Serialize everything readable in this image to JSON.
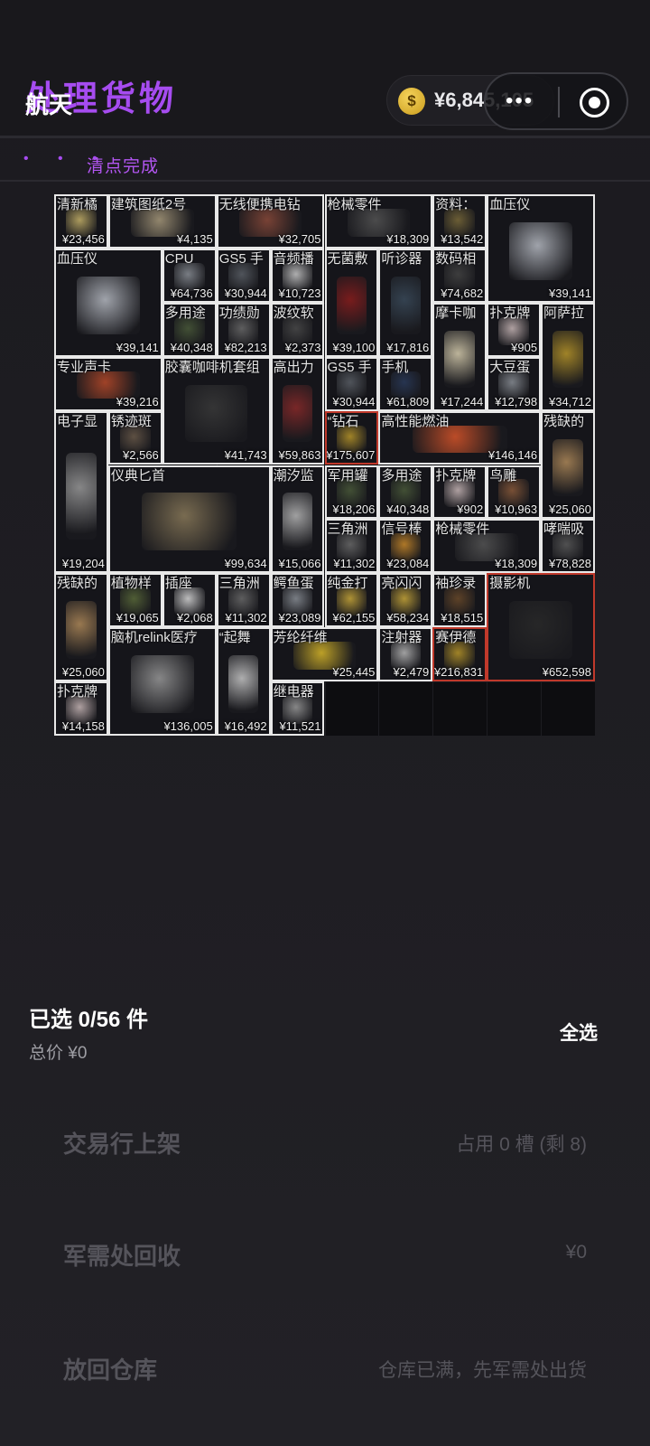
{
  "header": {
    "title": "处理货物",
    "subtitle": "航天",
    "currency_icon": "$",
    "currency_value": "¥6,845,105",
    "capsule_dots": "•••",
    "accent_color": "#a64cf0"
  },
  "status": {
    "dots": "• • •",
    "text": "清点完成"
  },
  "items": [
    {
      "name": "清新橘",
      "price": "¥23,456",
      "col": 0,
      "row": 0,
      "w": 1,
      "h": 1,
      "red": false,
      "color": "#c7b36a"
    },
    {
      "name": "建筑图纸2号",
      "price": "¥4,135",
      "col": 1,
      "row": 0,
      "w": 2,
      "h": 1,
      "red": false,
      "color": "#a89a7c"
    },
    {
      "name": "无线便携电钻",
      "price": "¥32,705",
      "col": 3,
      "row": 0,
      "w": 2,
      "h": 1,
      "red": false,
      "color": "#8a4a3a"
    },
    {
      "name": "枪械零件",
      "price": "¥18,309",
      "col": 5,
      "row": 0,
      "w": 2,
      "h": 1,
      "red": false,
      "color": "#555555"
    },
    {
      "name": "资料：",
      "price": "¥13,542",
      "col": 7,
      "row": 0,
      "w": 1,
      "h": 1,
      "red": false,
      "color": "#7a6a3a"
    },
    {
      "name": "血压仪",
      "price": "¥39,141",
      "col": 8,
      "row": 0,
      "w": 2,
      "h": 2,
      "red": false,
      "color": "#b8bcc4"
    },
    {
      "name": "血压仪",
      "price": "¥39,141",
      "col": 0,
      "row": 1,
      "w": 2,
      "h": 2,
      "red": false,
      "color": "#b8bcc4"
    },
    {
      "name": "CPU",
      "price": "¥64,736",
      "col": 2,
      "row": 1,
      "w": 1,
      "h": 1,
      "red": false,
      "color": "#8a8f96"
    },
    {
      "name": "GS5 手",
      "price": "¥30,944",
      "col": 3,
      "row": 1,
      "w": 1,
      "h": 1,
      "red": false,
      "color": "#5a5f66"
    },
    {
      "name": "音频播",
      "price": "¥10,723",
      "col": 4,
      "row": 1,
      "w": 1,
      "h": 1,
      "red": false,
      "color": "#c9c9c9"
    },
    {
      "name": "无菌敷",
      "price": "¥39,100",
      "col": 5,
      "row": 1,
      "w": 1,
      "h": 2,
      "red": false,
      "color": "#8a1d1d"
    },
    {
      "name": "听诊器",
      "price": "¥17,816",
      "col": 6,
      "row": 1,
      "w": 1,
      "h": 2,
      "red": false,
      "color": "#3a4a5a"
    },
    {
      "name": "数码相",
      "price": "¥74,682",
      "col": 7,
      "row": 1,
      "w": 1,
      "h": 1,
      "red": false,
      "color": "#444444"
    },
    {
      "name": "多用途",
      "price": "¥40,348",
      "col": 2,
      "row": 2,
      "w": 1,
      "h": 1,
      "red": false,
      "color": "#4a5a3a"
    },
    {
      "name": "功绩勋",
      "price": "¥82,213",
      "col": 3,
      "row": 2,
      "w": 1,
      "h": 1,
      "red": false,
      "color": "#6a6a6a"
    },
    {
      "name": "波纹软",
      "price": "¥2,373",
      "col": 4,
      "row": 2,
      "w": 1,
      "h": 1,
      "red": false,
      "color": "#4a4a4a"
    },
    {
      "name": "摩卡咖",
      "price": "¥17,244",
      "col": 7,
      "row": 2,
      "w": 1,
      "h": 2,
      "red": false,
      "color": "#d9cfb0"
    },
    {
      "name": "扑克牌",
      "price": "¥905",
      "col": 8,
      "row": 2,
      "w": 1,
      "h": 1,
      "red": false,
      "color": "#c9b8b8"
    },
    {
      "name": "阿萨拉",
      "price": "¥34,712",
      "col": 9,
      "row": 2,
      "w": 1,
      "h": 2,
      "red": false,
      "color": "#b8962a"
    },
    {
      "name": "专业声卡",
      "price": "¥39,216",
      "col": 0,
      "row": 3,
      "w": 2,
      "h": 1,
      "red": false,
      "color": "#b84a2a"
    },
    {
      "name": "胶囊咖啡机套组",
      "price": "¥41,743",
      "col": 2,
      "row": 3,
      "w": 2,
      "h": 2,
      "red": false,
      "color": "#3a3a3a"
    },
    {
      "name": "高出力",
      "price": "¥59,863",
      "col": 4,
      "row": 3,
      "w": 1,
      "h": 2,
      "red": false,
      "color": "#8a2a2a"
    },
    {
      "name": "GS5 手",
      "price": "¥30,944",
      "col": 5,
      "row": 3,
      "w": 1,
      "h": 1,
      "red": false,
      "color": "#5a5f66"
    },
    {
      "name": "手机",
      "price": "¥61,809",
      "col": 6,
      "row": 3,
      "w": 1,
      "h": 1,
      "red": false,
      "color": "#2a3a5a"
    },
    {
      "name": "大豆蛋",
      "price": "¥12,798",
      "col": 8,
      "row": 3,
      "w": 1,
      "h": 1,
      "red": false,
      "color": "#8a8f96"
    },
    {
      "name": "电子显",
      "price": "¥19,204",
      "col": 0,
      "row": 4,
      "w": 1,
      "h": 3,
      "red": false,
      "color": "#9a9a9a"
    },
    {
      "name": "锈迹斑",
      "price": "¥2,566",
      "col": 1,
      "row": 4,
      "w": 1,
      "h": 1,
      "red": false,
      "color": "#6a5a4a"
    },
    {
      "name": "“钻石",
      "price": "¥175,607",
      "col": 5,
      "row": 4,
      "w": 1,
      "h": 1,
      "red": true,
      "color": "#b8962a"
    },
    {
      "name": "高性能燃油",
      "price": "¥146,146",
      "col": 6,
      "row": 4,
      "w": 3,
      "h": 1,
      "red": false,
      "color": "#d8552a"
    },
    {
      "name": "残缺的",
      "price": "¥25,060",
      "col": 9,
      "row": 4,
      "w": 1,
      "h": 2,
      "red": false,
      "color": "#b08a5a"
    },
    {
      "name": "仪典匕首",
      "price": "¥99,634",
      "col": 1,
      "row": 5,
      "w": 3,
      "h": 2,
      "red": false,
      "color": "#8a7a5a"
    },
    {
      "name": "潮汐监",
      "price": "¥15,066",
      "col": 4,
      "row": 5,
      "w": 1,
      "h": 2,
      "red": false,
      "color": "#b8b8b8"
    },
    {
      "name": "军用罐",
      "price": "¥18,206",
      "col": 5,
      "row": 5,
      "w": 1,
      "h": 1,
      "red": false,
      "color": "#4a5a3a"
    },
    {
      "name": "多用途",
      "price": "¥40,348",
      "col": 6,
      "row": 5,
      "w": 1,
      "h": 1,
      "red": false,
      "color": "#4a5a3a"
    },
    {
      "name": "扑克牌",
      "price": "¥902",
      "col": 7,
      "row": 5,
      "w": 1,
      "h": 1,
      "red": false,
      "color": "#c9b8b8"
    },
    {
      "name": "鸟雕",
      "price": "¥10,963",
      "col": 8,
      "row": 5,
      "w": 1,
      "h": 1,
      "red": false,
      "color": "#8a5a3a"
    },
    {
      "name": "三角洲",
      "price": "¥11,302",
      "col": 5,
      "row": 6,
      "w": 1,
      "h": 1,
      "red": false,
      "color": "#6a6a6a"
    },
    {
      "name": "信号棒",
      "price": "¥23,084",
      "col": 6,
      "row": 6,
      "w": 1,
      "h": 1,
      "red": false,
      "color": "#c9892a"
    },
    {
      "name": "枪械零件",
      "price": "¥18,309",
      "col": 7,
      "row": 6,
      "w": 2,
      "h": 1,
      "red": false,
      "color": "#555555"
    },
    {
      "name": "哮喘吸",
      "price": "¥78,828",
      "col": 9,
      "row": 6,
      "w": 1,
      "h": 1,
      "red": false,
      "color": "#5a5a5a"
    },
    {
      "name": "残缺的",
      "price": "¥25,060",
      "col": 0,
      "row": 7,
      "w": 1,
      "h": 2,
      "red": false,
      "color": "#b08a5a"
    },
    {
      "name": "植物样",
      "price": "¥19,065",
      "col": 1,
      "row": 7,
      "w": 1,
      "h": 1,
      "red": false,
      "color": "#5a6a3a"
    },
    {
      "name": "插座",
      "price": "¥2,068",
      "col": 2,
      "row": 7,
      "w": 1,
      "h": 1,
      "red": false,
      "color": "#d9d9d9"
    },
    {
      "name": "三角洲",
      "price": "¥11,302",
      "col": 3,
      "row": 7,
      "w": 1,
      "h": 1,
      "red": false,
      "color": "#6a6a6a"
    },
    {
      "name": "鳄鱼蛋",
      "price": "¥23,089",
      "col": 4,
      "row": 7,
      "w": 1,
      "h": 1,
      "red": false,
      "color": "#8a8f96"
    },
    {
      "name": "纯金打",
      "price": "¥62,155",
      "col": 5,
      "row": 7,
      "w": 1,
      "h": 1,
      "red": false,
      "color": "#c9a83a"
    },
    {
      "name": "亮闪闪",
      "price": "¥58,234",
      "col": 6,
      "row": 7,
      "w": 1,
      "h": 1,
      "red": false,
      "color": "#c9a83a"
    },
    {
      "name": "袖珍录",
      "price": "¥18,515",
      "col": 7,
      "row": 7,
      "w": 1,
      "h": 1,
      "red": false,
      "color": "#6a4a2a"
    },
    {
      "name": "摄影机",
      "price": "¥652,598",
      "col": 8,
      "row": 7,
      "w": 2,
      "h": 2,
      "red": true,
      "color": "#2a2a2a"
    },
    {
      "name": "脑机relink医疗",
      "price": "¥136,005",
      "col": 1,
      "row": 8,
      "w": 2,
      "h": 2,
      "red": false,
      "color": "#9a9a9a"
    },
    {
      "name": "“起舞",
      "price": "¥16,492",
      "col": 3,
      "row": 8,
      "w": 1,
      "h": 2,
      "red": false,
      "color": "#c9c9c9"
    },
    {
      "name": "芳纶纤维",
      "price": "¥25,445",
      "col": 4,
      "row": 8,
      "w": 2,
      "h": 1,
      "red": false,
      "color": "#d9b82a"
    },
    {
      "name": "注射器",
      "price": "¥2,479",
      "col": 6,
      "row": 8,
      "w": 1,
      "h": 1,
      "red": false,
      "color": "#b8b8b8"
    },
    {
      "name": "赛伊德",
      "price": "¥216,831",
      "col": 7,
      "row": 8,
      "w": 1,
      "h": 1,
      "red": true,
      "color": "#b8962a"
    },
    {
      "name": "扑克牌",
      "price": "¥14,158",
      "col": 0,
      "row": 9,
      "w": 1,
      "h": 1,
      "red": false,
      "color": "#c9b8b8"
    },
    {
      "name": "继电器",
      "price": "¥11,521",
      "col": 4,
      "row": 9,
      "w": 1,
      "h": 1,
      "red": false,
      "color": "#9a9a9a"
    }
  ],
  "selection": {
    "selected_text": "已选 0/56 件",
    "select_all": "全选",
    "total_text": "总价  ¥0"
  },
  "actions": [
    {
      "title": "交易行上架",
      "info": "占用 0 槽 (剩 8)"
    },
    {
      "title": "军需处回收",
      "info": "¥0"
    },
    {
      "title": "放回仓库",
      "info": "仓库已满，先军需处出货"
    }
  ]
}
